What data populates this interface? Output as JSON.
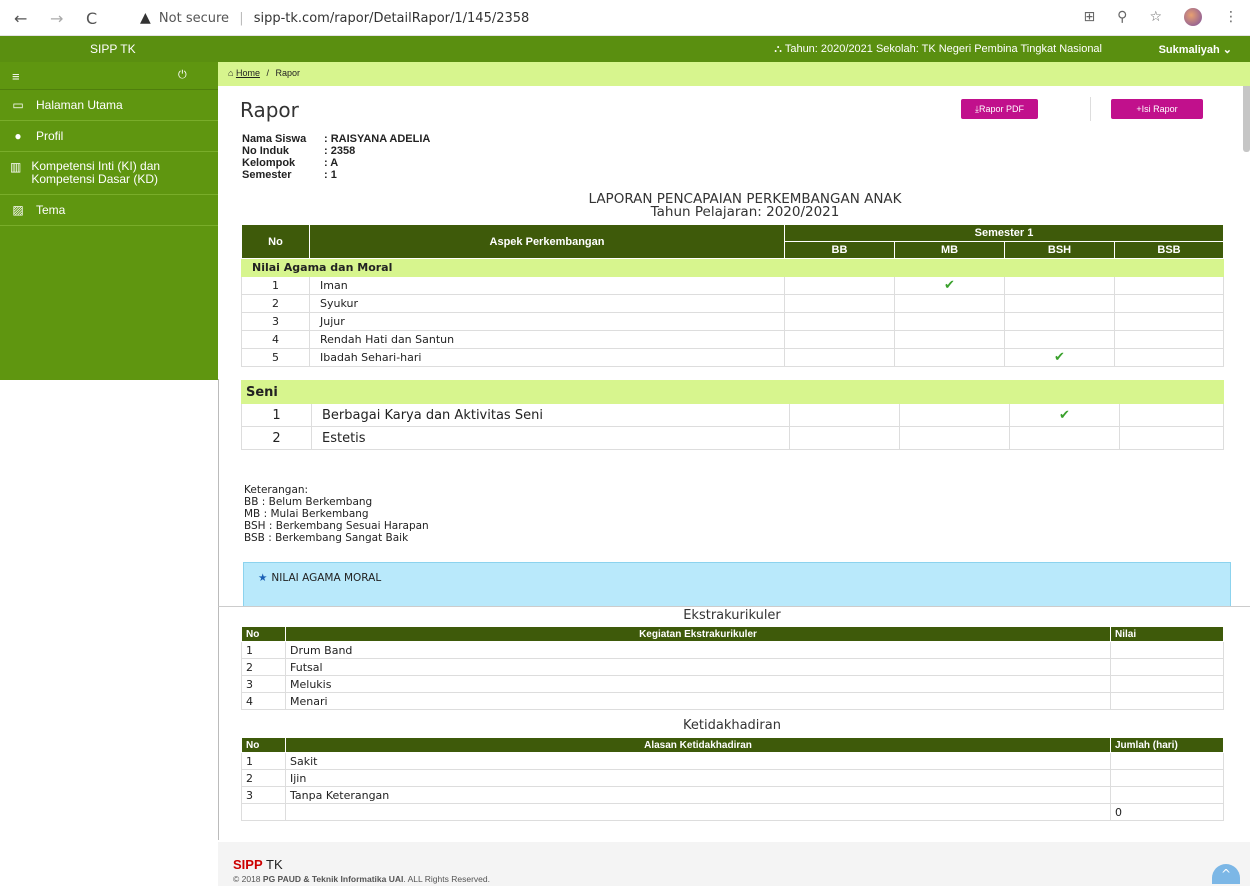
{
  "browser": {
    "back": "←",
    "forward": "→",
    "reload": "C",
    "warning": "▲",
    "security": "Not secure",
    "url": "sipp-tk.com/rapor/DetailRapor/1/145/2358"
  },
  "header": {
    "brand": "SIPP TK",
    "info": "Tahun: 2020/2021 Sekolah: TK Negeri Pembina Tingkat Nasional",
    "user": "Sukmaliyah"
  },
  "sidebar": {
    "items": [
      {
        "label": "Halaman Utama",
        "icon": "monitor-icon"
      },
      {
        "label": "Profil",
        "icon": "user-icon"
      },
      {
        "label": "Kompetensi Inti (KI) dan Kompetensi Dasar (KD)",
        "icon": "chart-icon"
      },
      {
        "label": "Tema",
        "icon": "image-icon"
      }
    ]
  },
  "breadcrumb": {
    "home": "Home",
    "sep": "/",
    "current": "Rapor"
  },
  "page": {
    "title": "Rapor",
    "btn_pdf": "Rapor PDF",
    "btn_isi": "Isi Rapor"
  },
  "student": {
    "name_label": "Nama Siswa",
    "name": ": RAISYANA ADELIA",
    "induk_label": "No Induk",
    "induk": ": 2358",
    "kelompok_label": "Kelompok",
    "kelompok": ": A",
    "semester_label": "Semester",
    "semester": ": 1"
  },
  "report": {
    "title": "LAPORAN PENCAPAIAN PERKEMBANGAN ANAK",
    "subtitle": "Tahun Pelajaran: 2020/2021",
    "col_no": "No",
    "col_aspek": "Aspek Perkembangan",
    "col_semester": "Semester 1",
    "levels": [
      "BB",
      "MB",
      "BSH",
      "BSB"
    ],
    "section1": "Nilai Agama dan Moral",
    "rows1": [
      {
        "no": "1",
        "aspek": "Iman",
        "mark": "MB"
      },
      {
        "no": "2",
        "aspek": "Syukur",
        "mark": ""
      },
      {
        "no": "3",
        "aspek": "Jujur",
        "mark": ""
      },
      {
        "no": "4",
        "aspek": "Rendah Hati dan Santun",
        "mark": ""
      },
      {
        "no": "5",
        "aspek": "Ibadah Sehari-hari",
        "mark": "BSH"
      }
    ],
    "section2": "Seni",
    "rows2": [
      {
        "no": "1",
        "aspek": "Berbagai Karya dan Aktivitas Seni",
        "mark": "BSH"
      },
      {
        "no": "2",
        "aspek": "Estetis",
        "mark": ""
      }
    ]
  },
  "keterangan": {
    "title": "Keterangan:",
    "lines": [
      "BB : Belum Berkembang",
      "MB : Mulai Berkembang",
      "BSH : Berkembang Sesuai Harapan",
      "BSB : Berkembang Sangat Baik"
    ]
  },
  "alert": {
    "label": "NILAI AGAMA MORAL"
  },
  "ekstra": {
    "caption": "Ekstrakurikuler",
    "col_no": "No",
    "col_kegiatan": "Kegiatan Ekstrakurikuler",
    "col_nilai": "Nilai",
    "rows": [
      {
        "no": "1",
        "kegiatan": "Drum Band",
        "nilai": ""
      },
      {
        "no": "2",
        "kegiatan": "Futsal",
        "nilai": ""
      },
      {
        "no": "3",
        "kegiatan": "Melukis",
        "nilai": ""
      },
      {
        "no": "4",
        "kegiatan": "Menari",
        "nilai": ""
      }
    ]
  },
  "absen": {
    "caption": "Ketidakhadiran",
    "col_no": "No",
    "col_alasan": "Alasan Ketidakhadiran",
    "col_jumlah": "Jumlah (hari)",
    "rows": [
      {
        "no": "1",
        "alasan": "Sakit",
        "jumlah": ""
      },
      {
        "no": "2",
        "alasan": "Ijin",
        "jumlah": ""
      },
      {
        "no": "3",
        "alasan": "Tanpa Keterangan",
        "jumlah": ""
      }
    ],
    "total": "0"
  },
  "footer": {
    "brand_red": "SIPP",
    "brand_rest": " TK",
    "copy_prefix": "© 2018 ",
    "copy_bold": "PG PAUD & Teknik Informatika UAI",
    "copy_suffix": ". ALL Rights Reserved."
  },
  "colors": {
    "green": "#5a8f10",
    "lightgreen": "#d7f58e",
    "darkgreen": "#3e5a0a",
    "magenta": "#c1108c"
  }
}
